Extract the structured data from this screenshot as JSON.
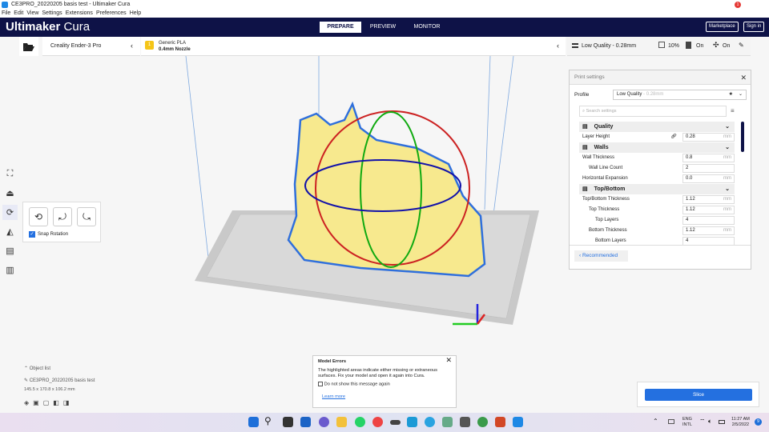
{
  "window": {
    "title": "CE3PRO_20220205 basis test - Ultimaker Cura"
  },
  "menu": [
    "File",
    "Edit",
    "View",
    "Settings",
    "Extensions",
    "Preferences",
    "Help"
  ],
  "header": {
    "brand_bold": "Ultimaker",
    "brand_light": "Cura",
    "tabs": [
      "PREPARE",
      "PREVIEW",
      "MONITOR"
    ],
    "active_tab": "PREPARE",
    "marketplace": "Marketplace",
    "marketplace_badge": "1",
    "signin": "Sign in"
  },
  "stage": {
    "printer": "Creality Ender-3 Pro",
    "extruder_number": "1",
    "material": "Generic PLA",
    "nozzle": "0.4mm Nozzle",
    "quality": "Low Quality - 0.28mm",
    "infill": "10%",
    "support": "On",
    "adhesion": "On"
  },
  "rotate_panel": {
    "snap_label": "Snap Rotation",
    "snap_checked": true
  },
  "print_settings": {
    "title": "Print settings",
    "profile_label": "Profile",
    "profile_value": "Low Quality",
    "profile_suffix": "- 0.28mm",
    "search_placeholder": "Search settings",
    "rows": [
      {
        "type": "cat",
        "label": "Quality"
      },
      {
        "type": "set",
        "label": "Layer Height",
        "value": "0.28",
        "unit": "mm",
        "indent": 0,
        "link": true
      },
      {
        "type": "cat",
        "label": "Walls"
      },
      {
        "type": "set",
        "label": "Wall Thickness",
        "value": "0.8",
        "unit": "mm",
        "indent": 0
      },
      {
        "type": "set",
        "label": "Wall Line Count",
        "value": "2",
        "unit": "",
        "indent": 1
      },
      {
        "type": "set",
        "label": "Horizontal Expansion",
        "value": "0.0",
        "unit": "mm",
        "indent": 0
      },
      {
        "type": "cat",
        "label": "Top/Bottom"
      },
      {
        "type": "set",
        "label": "Top/Bottom Thickness",
        "value": "1.12",
        "unit": "mm",
        "indent": 0
      },
      {
        "type": "set",
        "label": "Top Thickness",
        "value": "1.12",
        "unit": "mm",
        "indent": 1
      },
      {
        "type": "set",
        "label": "Top Layers",
        "value": "4",
        "unit": "",
        "indent": 2
      },
      {
        "type": "set",
        "label": "Bottom Thickness",
        "value": "1.12",
        "unit": "mm",
        "indent": 1
      },
      {
        "type": "set",
        "label": "Bottom Layers",
        "value": "4",
        "unit": "",
        "indent": 2
      }
    ],
    "recommended": "Recommended"
  },
  "object_list": {
    "label": "Object list",
    "object_name": "CE3PRO_20220205 basis test",
    "dimensions": "145.5 x 170.8 x 106.2 mm"
  },
  "model_errors": {
    "title": "Model Errors",
    "message": "The highlighted areas indicate either missing or extraneous surfaces. Fix your model and open it again into Cura.",
    "checkbox": "Do not show this message again",
    "link": "Learn more"
  },
  "slice": {
    "label": "Slice"
  },
  "taskbar": {
    "lang1": "ENG",
    "lang2": "INTL",
    "time": "11:27 AM",
    "date": "2/5/2022",
    "notif": "9"
  },
  "colors": {
    "header": "#0e1247",
    "accent": "#2470e0",
    "model": "#f7e98e"
  }
}
